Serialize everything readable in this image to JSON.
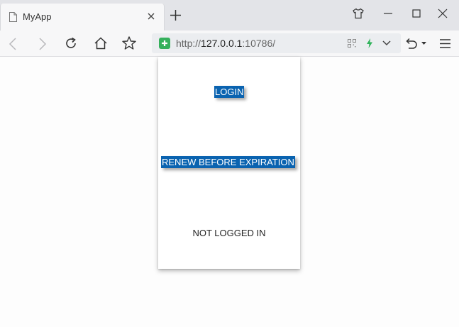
{
  "browser": {
    "tab_title": "MyApp",
    "url_scheme": "http://",
    "url_host": "127.0.0.1",
    "url_port": ":10786/",
    "accent_green": "#35b05c"
  },
  "app": {
    "login_label": "LOGIN",
    "renew_label": "RENEW BEFORE EXPIRATION",
    "status_text": "NOT LOGGED IN",
    "button_color": "#0a63b0"
  }
}
